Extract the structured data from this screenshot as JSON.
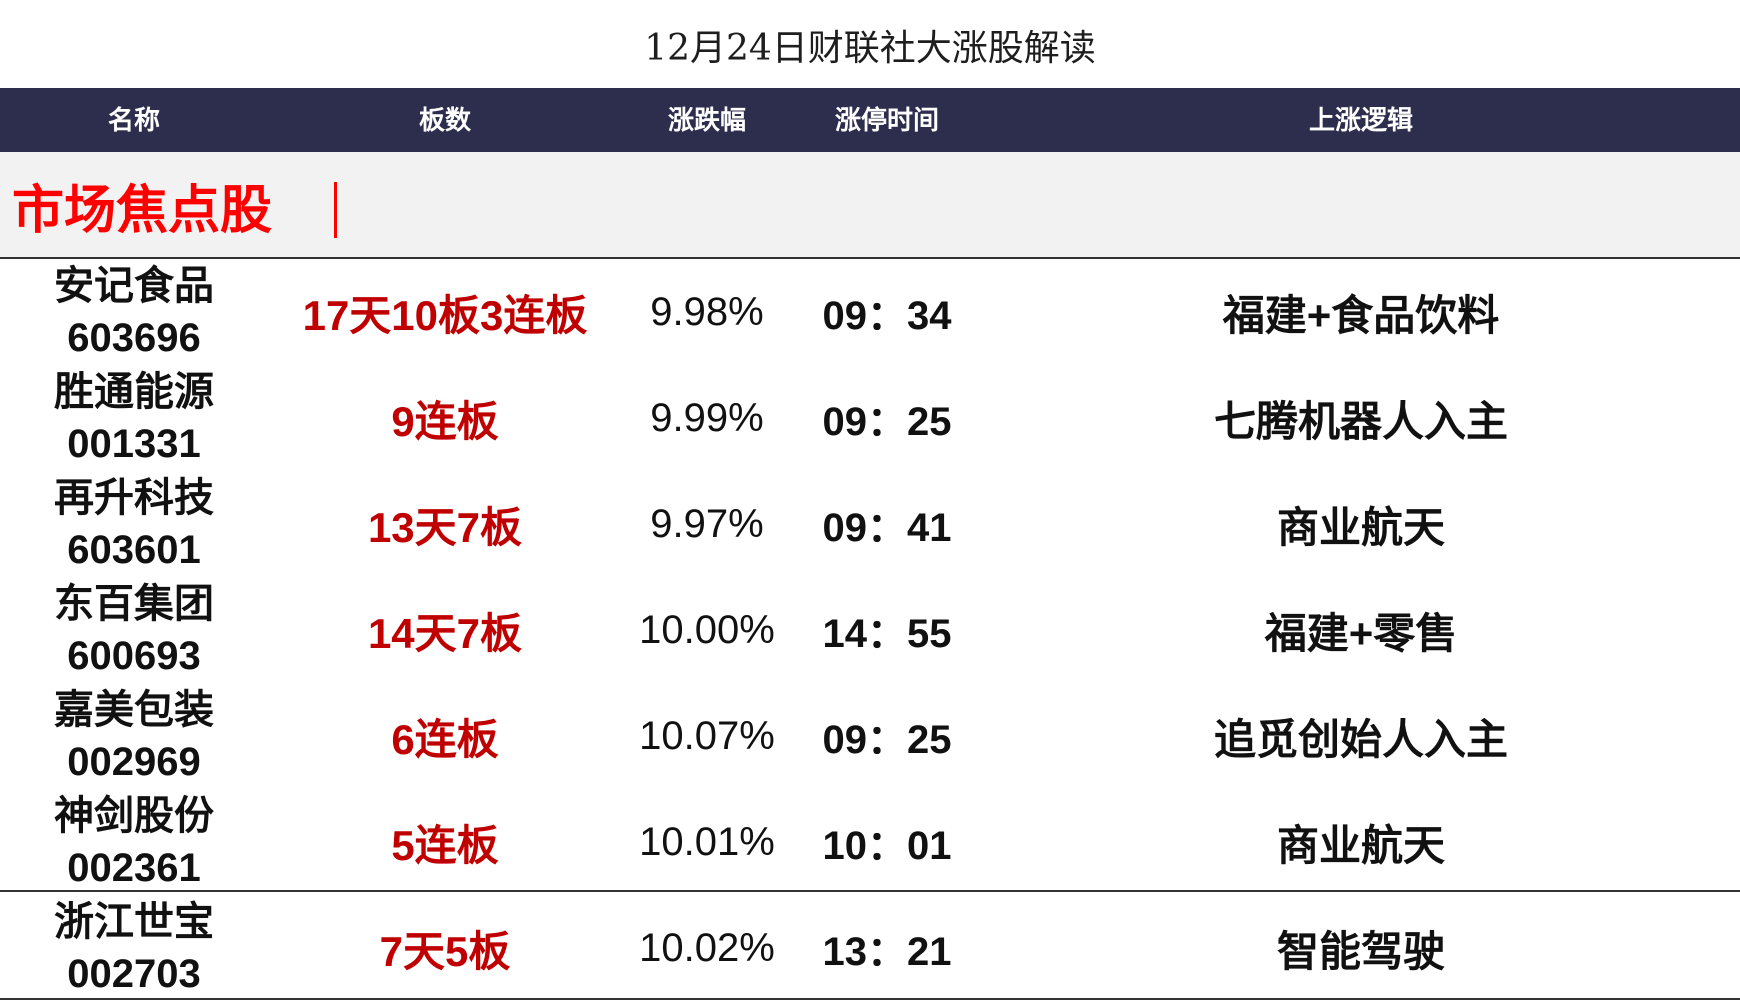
{
  "title": "12月24日财联社大涨股解读",
  "headers": {
    "name": "名称",
    "board": "板数",
    "change": "涨跌幅",
    "limit_time": "涨停时间",
    "logic": "上涨逻辑"
  },
  "section": {
    "label": "市场焦点股",
    "separator": "|"
  },
  "colors": {
    "header_bg": "#2d2d4d",
    "section_bg": "#f2f2f2",
    "section_text": "#ff0000",
    "board_text": "#c00000"
  },
  "rows": [
    {
      "name": "安记食品",
      "code": "603696",
      "board": "17天10板3连板",
      "change": "9.98%",
      "time": "09：34",
      "logic": "福建+食品饮料"
    },
    {
      "name": "胜通能源",
      "code": "001331",
      "board": "9连板",
      "change": "9.99%",
      "time": "09：25",
      "logic": "七腾机器人入主"
    },
    {
      "name": "再升科技",
      "code": "603601",
      "board": "13天7板",
      "change": "9.97%",
      "time": "09：41",
      "logic": "商业航天"
    },
    {
      "name": "东百集团",
      "code": "600693",
      "board": "14天7板",
      "change": "10.00%",
      "time": "14：55",
      "logic": "福建+零售"
    },
    {
      "name": "嘉美包装",
      "code": "002969",
      "board": "6连板",
      "change": "10.07%",
      "time": "09：25",
      "logic": "追觅创始人入主"
    },
    {
      "name": "神剑股份",
      "code": "002361",
      "board": "5连板",
      "change": "10.01%",
      "time": "10：01",
      "logic": "商业航天"
    },
    {
      "name": "浙江世宝",
      "code": "002703",
      "board": "7天5板",
      "change": "10.02%",
      "time": "13：21",
      "logic": "智能驾驶"
    }
  ]
}
